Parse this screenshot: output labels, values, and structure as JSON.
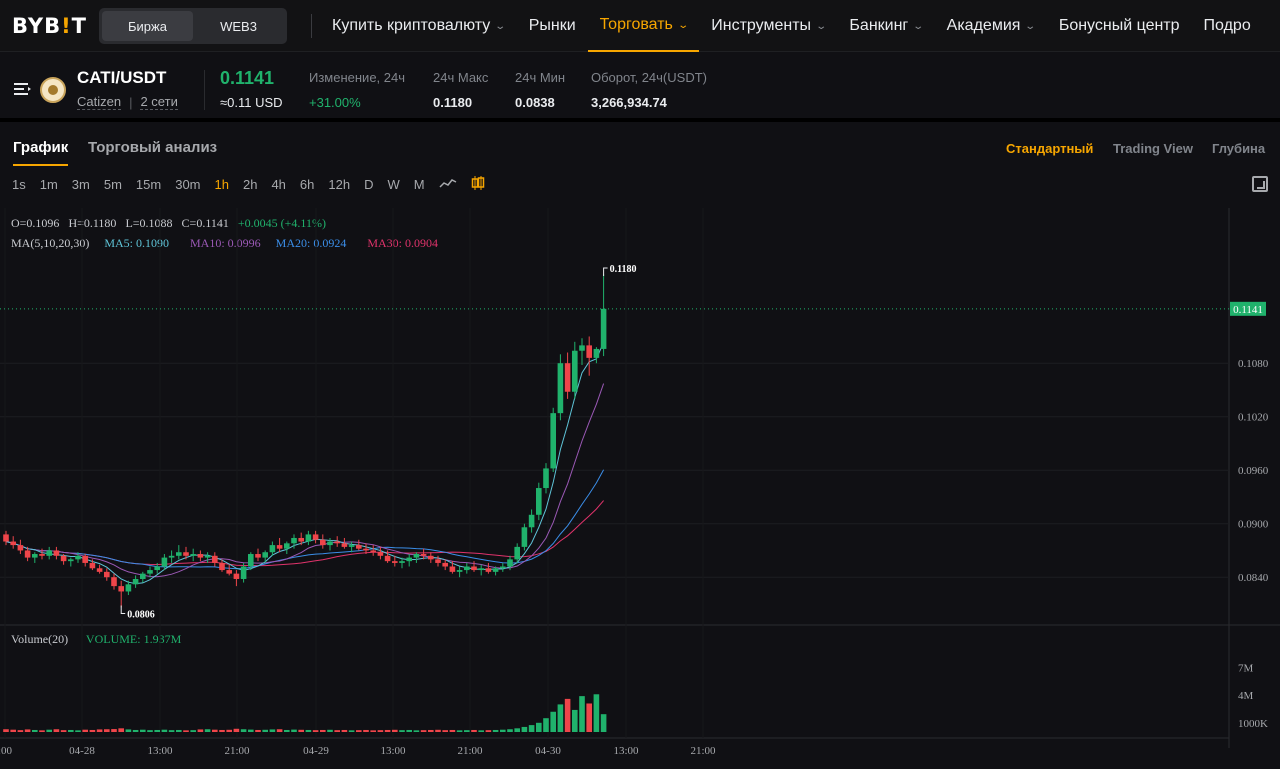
{
  "nav": {
    "logo_text": "BYB",
    "logo_bar": "!",
    "logo_end": "T",
    "segment": [
      {
        "label": "Биржа",
        "active": true
      },
      {
        "label": "WEB3",
        "active": false
      }
    ],
    "items": [
      {
        "label": "Купить криптовалюту",
        "chevron": true
      },
      {
        "label": "Рынки",
        "chevron": false
      },
      {
        "label": "Торговать",
        "chevron": true,
        "active": true
      },
      {
        "label": "Инструменты",
        "chevron": true
      },
      {
        "label": "Банкинг",
        "chevron": true
      },
      {
        "label": "Академия",
        "chevron": true
      },
      {
        "label": "Бонусный центр",
        "chevron": false
      },
      {
        "label": "Подро",
        "chevron": false
      }
    ]
  },
  "ticker": {
    "pair": "CATI/USDT",
    "name": "Catizen",
    "networks": "2 сети",
    "last_price": "0.1141",
    "last_usd": "≈0.11 USD",
    "stats": [
      {
        "label": "Изменение, 24ч",
        "value": "+31.00%",
        "green": true
      },
      {
        "label": "24ч Макс",
        "value": "0.1180",
        "green": false
      },
      {
        "label": "24ч Мин",
        "value": "0.0838",
        "green": false
      },
      {
        "label": "Оборот, 24ч(USDT)",
        "value": "3,266,934.74",
        "green": false
      }
    ]
  },
  "tabs": {
    "chart": "График",
    "analysis": "Торговый анализ",
    "views": [
      "Стандартный",
      "Trading View",
      "Глубина"
    ]
  },
  "intervals": [
    "1s",
    "1m",
    "3m",
    "5m",
    "15m",
    "30m",
    "1h",
    "2h",
    "4h",
    "6h",
    "12h",
    "D",
    "W",
    "M"
  ],
  "active_interval": "1h",
  "legend": {
    "o": "O=0.1096",
    "h": "H=0.1180",
    "l": "L=0.1088",
    "c": "C=0.1141",
    "chg": "+0.0045 (+4.11%)",
    "ma_label": "MA(5,10,20,30)",
    "ma5": "MA5: 0.1090",
    "ma10": "MA10: 0.0996",
    "ma20": "MA20: 0.0924",
    "ma30": "MA30: 0.0904",
    "vol_label": "Volume(20)",
    "vol_value": "VOLUME: 1.937M"
  },
  "colors": {
    "up": "#20b26c",
    "down": "#ef454a",
    "accent": "#f7a600"
  },
  "chart_data": {
    "type": "candlestick",
    "x_ticks": [
      ":00",
      "04-28",
      "13:00",
      "21:00",
      "04-29",
      "13:00",
      "21:00",
      "04-30",
      "13:00",
      "21:00"
    ],
    "y_ticks": [
      "0.1080",
      "0.1020",
      "0.0960",
      "0.0900",
      "0.0840"
    ],
    "y_tick_values": [
      0.108,
      0.102,
      0.096,
      0.09,
      0.084
    ],
    "ylim": [
      0.0792,
      0.1198
    ],
    "vol_ticks": [
      "7M",
      "4M",
      "1000K"
    ],
    "vol_tick_values": [
      7000000,
      4000000,
      1000000
    ],
    "vol_max": 10000000,
    "current_price_label": "0.1141",
    "current_price": 0.1141,
    "high_label": "0.1180",
    "low_label": "0.0806",
    "high_value": 0.118,
    "low_value": 0.0806,
    "candles": [
      [
        0.0888,
        0.0892,
        0.0876,
        0.088
      ],
      [
        0.088,
        0.0886,
        0.0872,
        0.0876
      ],
      [
        0.0876,
        0.0882,
        0.0866,
        0.087
      ],
      [
        0.087,
        0.0874,
        0.0858,
        0.0862
      ],
      [
        0.0862,
        0.0868,
        0.0856,
        0.0866
      ],
      [
        0.0866,
        0.0872,
        0.086,
        0.0864
      ],
      [
        0.0864,
        0.0874,
        0.086,
        0.087
      ],
      [
        0.087,
        0.0874,
        0.086,
        0.0864
      ],
      [
        0.0864,
        0.0866,
        0.0854,
        0.0858
      ],
      [
        0.0858,
        0.0862,
        0.0852,
        0.086
      ],
      [
        0.086,
        0.0868,
        0.0856,
        0.0864
      ],
      [
        0.0864,
        0.0866,
        0.0852,
        0.0856
      ],
      [
        0.0856,
        0.086,
        0.0848,
        0.085
      ],
      [
        0.085,
        0.0854,
        0.0844,
        0.0846
      ],
      [
        0.0846,
        0.085,
        0.0836,
        0.084
      ],
      [
        0.084,
        0.0844,
        0.0826,
        0.083
      ],
      [
        0.083,
        0.0836,
        0.0806,
        0.0824
      ],
      [
        0.0824,
        0.0836,
        0.082,
        0.0832
      ],
      [
        0.0832,
        0.0842,
        0.0828,
        0.0838
      ],
      [
        0.0838,
        0.0846,
        0.0834,
        0.0844
      ],
      [
        0.0844,
        0.0852,
        0.084,
        0.0848
      ],
      [
        0.0848,
        0.0856,
        0.0844,
        0.0852
      ],
      [
        0.0852,
        0.0866,
        0.0848,
        0.0862
      ],
      [
        0.0862,
        0.087,
        0.0856,
        0.0864
      ],
      [
        0.0864,
        0.0876,
        0.086,
        0.0868
      ],
      [
        0.0868,
        0.0874,
        0.086,
        0.0864
      ],
      [
        0.0864,
        0.0872,
        0.0858,
        0.0866
      ],
      [
        0.0866,
        0.087,
        0.0858,
        0.0862
      ],
      [
        0.0862,
        0.0868,
        0.0856,
        0.0864
      ],
      [
        0.0864,
        0.0868,
        0.0852,
        0.0856
      ],
      [
        0.0856,
        0.086,
        0.0846,
        0.0848
      ],
      [
        0.0848,
        0.0854,
        0.0842,
        0.0844
      ],
      [
        0.0844,
        0.0848,
        0.083,
        0.0838
      ],
      [
        0.0838,
        0.0856,
        0.0834,
        0.0852
      ],
      [
        0.0852,
        0.0868,
        0.0848,
        0.0866
      ],
      [
        0.0866,
        0.0872,
        0.0858,
        0.0862
      ],
      [
        0.0862,
        0.087,
        0.0856,
        0.0868
      ],
      [
        0.0868,
        0.088,
        0.0864,
        0.0876
      ],
      [
        0.0876,
        0.0884,
        0.0868,
        0.0872
      ],
      [
        0.0872,
        0.088,
        0.0866,
        0.0878
      ],
      [
        0.0878,
        0.0888,
        0.0872,
        0.0884
      ],
      [
        0.0884,
        0.089,
        0.0876,
        0.088
      ],
      [
        0.088,
        0.0892,
        0.0876,
        0.0888
      ],
      [
        0.0888,
        0.0892,
        0.0878,
        0.0882
      ],
      [
        0.0882,
        0.0888,
        0.0872,
        0.0876
      ],
      [
        0.0876,
        0.0884,
        0.087,
        0.088
      ],
      [
        0.088,
        0.0886,
        0.0874,
        0.0878
      ],
      [
        0.0878,
        0.0884,
        0.0872,
        0.0874
      ],
      [
        0.0874,
        0.088,
        0.0868,
        0.0876
      ],
      [
        0.0876,
        0.0882,
        0.087,
        0.0872
      ],
      [
        0.0872,
        0.0878,
        0.0866,
        0.087
      ],
      [
        0.087,
        0.0876,
        0.0864,
        0.0868
      ],
      [
        0.0868,
        0.0874,
        0.086,
        0.0864
      ],
      [
        0.0864,
        0.087,
        0.0856,
        0.0858
      ],
      [
        0.0858,
        0.0864,
        0.0852,
        0.0856
      ],
      [
        0.0856,
        0.0862,
        0.085,
        0.0858
      ],
      [
        0.0858,
        0.0866,
        0.0852,
        0.0862
      ],
      [
        0.0862,
        0.0868,
        0.0856,
        0.0866
      ],
      [
        0.0866,
        0.0872,
        0.086,
        0.0864
      ],
      [
        0.0864,
        0.0868,
        0.0856,
        0.086
      ],
      [
        0.086,
        0.0864,
        0.0852,
        0.0856
      ],
      [
        0.0856,
        0.086,
        0.0848,
        0.0852
      ],
      [
        0.0852,
        0.0858,
        0.0844,
        0.0846
      ],
      [
        0.0846,
        0.0852,
        0.084,
        0.0848
      ],
      [
        0.0848,
        0.0856,
        0.0844,
        0.0852
      ],
      [
        0.0852,
        0.0858,
        0.0846,
        0.0848
      ],
      [
        0.0848,
        0.0854,
        0.0842,
        0.085
      ],
      [
        0.085,
        0.0856,
        0.0844,
        0.0846
      ],
      [
        0.0846,
        0.0852,
        0.0842,
        0.085
      ],
      [
        0.085,
        0.0856,
        0.0846,
        0.0852
      ],
      [
        0.0852,
        0.0864,
        0.0848,
        0.086
      ],
      [
        0.086,
        0.0878,
        0.0856,
        0.0874
      ],
      [
        0.0874,
        0.09,
        0.087,
        0.0896
      ],
      [
        0.0896,
        0.0916,
        0.089,
        0.091
      ],
      [
        0.091,
        0.0946,
        0.0904,
        0.094
      ],
      [
        0.094,
        0.0968,
        0.0934,
        0.0962
      ],
      [
        0.0962,
        0.103,
        0.0958,
        0.1024
      ],
      [
        0.1024,
        0.109,
        0.1016,
        0.108
      ],
      [
        0.108,
        0.1092,
        0.104,
        0.1048
      ],
      [
        0.1048,
        0.1104,
        0.104,
        0.1094
      ],
      [
        0.1094,
        0.1108,
        0.1078,
        0.11
      ],
      [
        0.11,
        0.111,
        0.1066,
        0.1086
      ],
      [
        0.1086,
        0.1098,
        0.108,
        0.1096
      ],
      [
        0.1096,
        0.118,
        0.1088,
        0.1141
      ]
    ],
    "volume": [
      0.3,
      0.25,
      0.2,
      0.28,
      0.22,
      0.18,
      0.25,
      0.3,
      0.2,
      0.22,
      0.18,
      0.25,
      0.22,
      0.28,
      0.3,
      0.32,
      0.4,
      0.28,
      0.22,
      0.25,
      0.2,
      0.22,
      0.25,
      0.2,
      0.22,
      0.18,
      0.2,
      0.28,
      0.3,
      0.25,
      0.22,
      0.24,
      0.35,
      0.3,
      0.26,
      0.22,
      0.24,
      0.28,
      0.3,
      0.22,
      0.26,
      0.24,
      0.22,
      0.2,
      0.22,
      0.24,
      0.2,
      0.22,
      0.18,
      0.2,
      0.22,
      0.18,
      0.2,
      0.22,
      0.24,
      0.2,
      0.22,
      0.18,
      0.2,
      0.22,
      0.24,
      0.2,
      0.22,
      0.18,
      0.2,
      0.22,
      0.18,
      0.2,
      0.22,
      0.25,
      0.3,
      0.4,
      0.55,
      0.75,
      1.0,
      1.5,
      2.2,
      3.0,
      3.6,
      2.4,
      3.9,
      3.1,
      4.1,
      1.937
    ],
    "ma5": [],
    "ma10": [],
    "ma20": [],
    "ma30": []
  }
}
